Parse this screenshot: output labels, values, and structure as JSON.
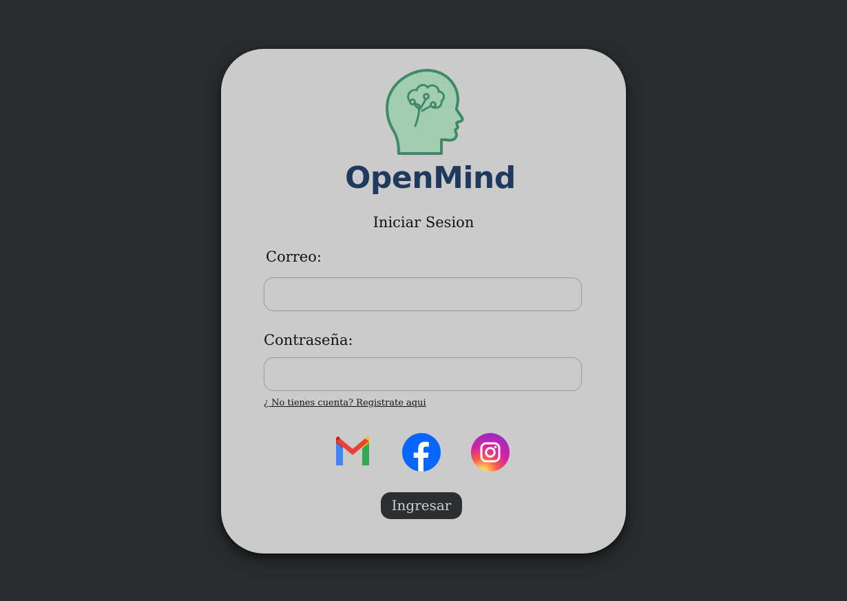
{
  "logo": {
    "icon": "brain-head-icon",
    "brand_name": "OpenMind",
    "colors": {
      "head_fill": "#a3cdb1",
      "head_stroke": "#3e8a68",
      "text": "#1f3a5c"
    }
  },
  "form": {
    "title": "Iniciar Sesion",
    "email_label": "Correo:",
    "email_value": "",
    "password_label": "Contraseña:",
    "password_value": "",
    "register_link": "¿ No tienes cuenta? Registrate aqui",
    "submit_label": "Ingresar"
  },
  "social": [
    {
      "name": "gmail",
      "icon": "gmail-icon"
    },
    {
      "name": "facebook",
      "icon": "facebook-icon",
      "color": "#0866ff"
    },
    {
      "name": "instagram",
      "icon": "instagram-icon"
    }
  ],
  "colors": {
    "background": "#2a2d2f",
    "card": "#cbcbcb",
    "button": "#2b2f31"
  }
}
